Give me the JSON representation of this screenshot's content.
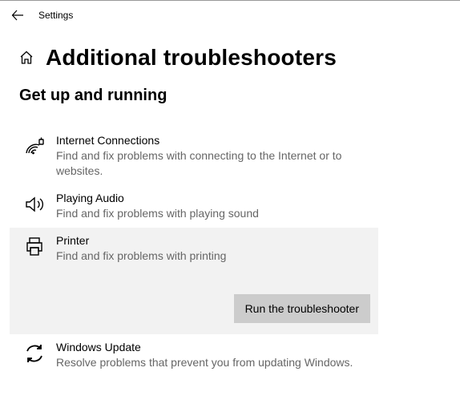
{
  "window": {
    "title": "Settings"
  },
  "page": {
    "title": "Additional troubleshooters"
  },
  "section": {
    "heading": "Get up and running"
  },
  "items": {
    "internet": {
      "title": "Internet Connections",
      "desc": "Find and fix problems with connecting to the Internet or to websites."
    },
    "audio": {
      "title": "Playing Audio",
      "desc": "Find and fix problems with playing sound"
    },
    "printer": {
      "title": "Printer",
      "desc": "Find and fix problems with printing"
    },
    "update": {
      "title": "Windows Update",
      "desc": "Resolve problems that prevent you from updating Windows."
    }
  },
  "buttons": {
    "run": "Run the troubleshooter"
  }
}
